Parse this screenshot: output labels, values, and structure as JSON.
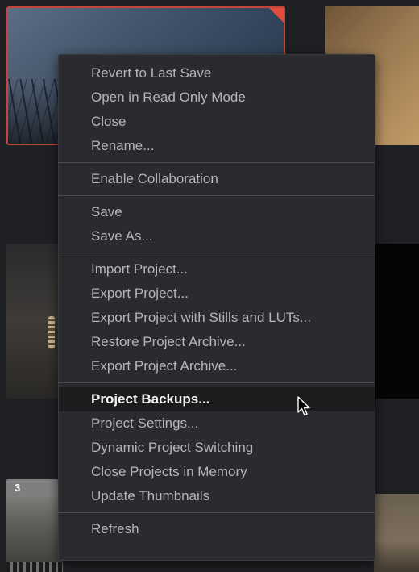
{
  "thumbnails": {
    "badge_number": "3"
  },
  "menu": {
    "groups": [
      [
        "Revert to Last Save",
        "Open in Read Only Mode",
        "Close",
        "Rename..."
      ],
      [
        "Enable Collaboration"
      ],
      [
        "Save",
        "Save As..."
      ],
      [
        "Import Project...",
        "Export Project...",
        "Export Project with Stills and LUTs...",
        "Restore Project Archive...",
        "Export Project Archive..."
      ],
      [
        "Project Backups...",
        "Project Settings...",
        "Dynamic Project Switching",
        "Close Projects in Memory",
        "Update Thumbnails"
      ],
      [
        "Refresh"
      ]
    ],
    "highlighted_item": "Project Backups..."
  },
  "colors": {
    "accent_red": "#e24c3a",
    "menu_bg": "#2a2b2e",
    "highlight_bg": "#1b1c1e"
  },
  "icons": {
    "cursor": "arrow-cursor-icon"
  }
}
